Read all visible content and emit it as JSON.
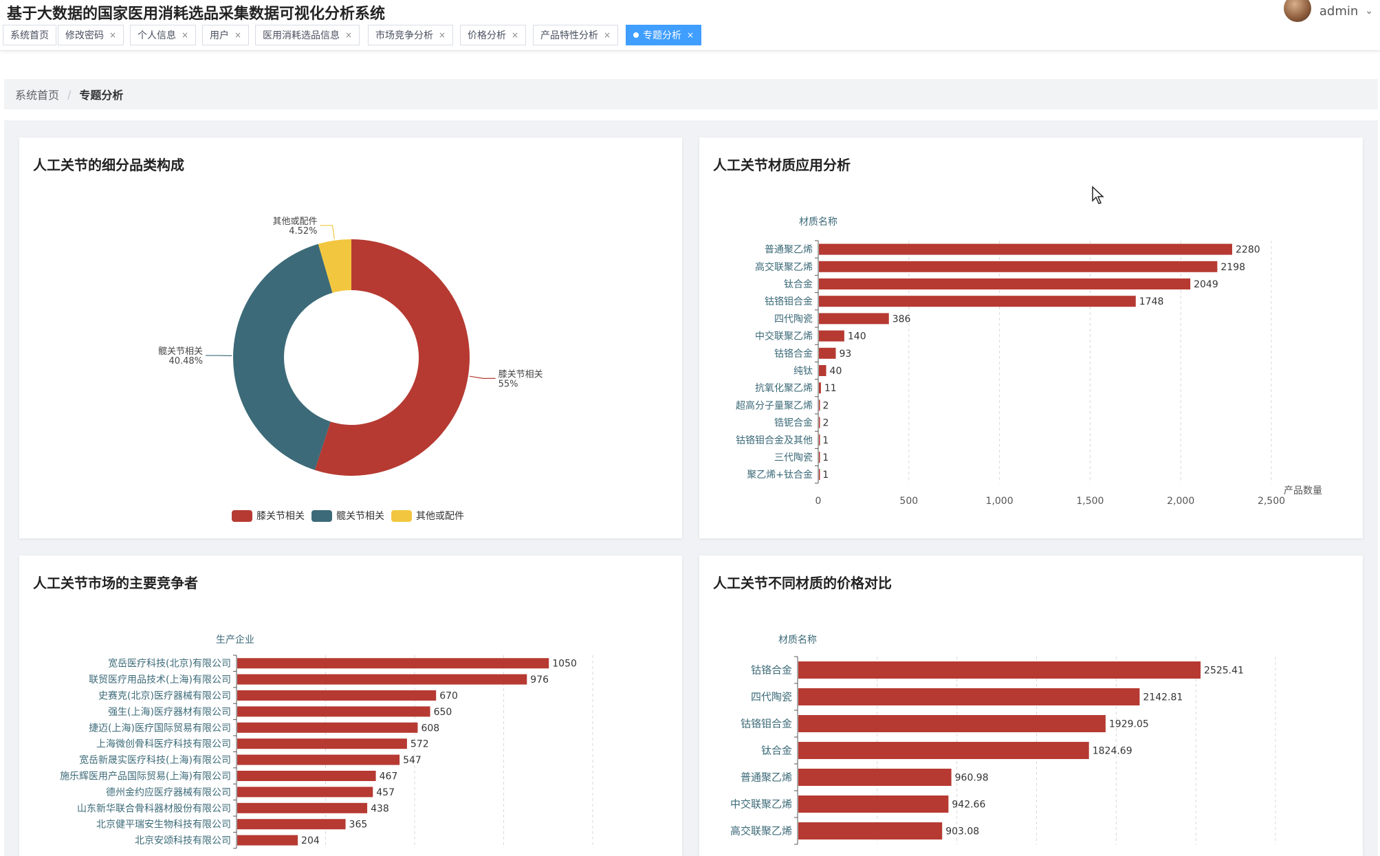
{
  "app": {
    "title": "基于大数据的国家医用消耗选品采集数据可视化分析系统",
    "user": "admin"
  },
  "tabs": [
    {
      "label": "系统首页",
      "closable": false
    },
    {
      "label": "修改密码",
      "closable": true
    },
    {
      "label": "个人信息",
      "closable": true
    },
    {
      "label": "用户",
      "closable": true
    },
    {
      "label": "医用消耗选品信息",
      "closable": true
    },
    {
      "label": "市场竞争分析",
      "closable": true
    },
    {
      "label": "价格分析",
      "closable": true
    },
    {
      "label": "产品特性分析",
      "closable": true
    },
    {
      "label": "专题分析",
      "closable": true,
      "active": true
    }
  ],
  "breadcrumb": {
    "home": "系统首页",
    "sep": "/",
    "current": "专题分析"
  },
  "panels": [
    {
      "title": "人工关节的细分品类构成"
    },
    {
      "title": "人工关节材质应用分析"
    },
    {
      "title": "人工关节市场的主要竞争者"
    },
    {
      "title": "人工关节不同材质的价格对比"
    }
  ],
  "colors": {
    "bar": "#b63a32",
    "pie": [
      "#b63a32",
      "#3c6a78",
      "#f3c63f"
    ],
    "active_tab": "#409eff",
    "axis_label": "#3c6a78"
  },
  "chart_data": [
    {
      "type": "pie",
      "variant": "donut",
      "title": "人工关节的细分品类构成",
      "slices": [
        {
          "name": "膝关节相关",
          "pct_label": "55%",
          "value": 55.0
        },
        {
          "name": "髋关节相关",
          "pct_label": "40.48%",
          "value": 40.48
        },
        {
          "name": "其他或配件",
          "pct_label": "4.52%",
          "value": 4.52
        }
      ],
      "legend": [
        "膝关节相关",
        "髋关节相关",
        "其他或配件"
      ],
      "legend_position": "bottom"
    },
    {
      "type": "bar",
      "orientation": "horizontal",
      "title": "人工关节材质应用分析",
      "ylabel": "材质名称",
      "xlabel": "产品数量",
      "categories": [
        "普通聚乙烯",
        "高交联聚乙烯",
        "钛合金",
        "钴铬钼合金",
        "四代陶瓷",
        "中交联聚乙烯",
        "钴铬合金",
        "纯钛",
        "抗氧化聚乙烯",
        "超高分子量聚乙烯",
        "锆铌合金",
        "钴铬钼合金及其他",
        "三代陶瓷",
        "聚乙烯+钛合金"
      ],
      "values": [
        2280,
        2198,
        2049,
        1748,
        386,
        140,
        93,
        40,
        11,
        2,
        2,
        1,
        1,
        1
      ],
      "xlim": [
        0,
        2500
      ],
      "xticks": [
        "0",
        "500",
        "1,000",
        "1,500",
        "2,000",
        "2,500"
      ],
      "grid": "vertical-dashed"
    },
    {
      "type": "bar",
      "orientation": "horizontal",
      "title": "人工关节市场的主要竞争者",
      "ylabel": "生产企业",
      "categories": [
        "宽岳医疗科技(北京)有限公司",
        "联贸医疗用品技术(上海)有限公司",
        "史赛克(北京)医疗器械有限公司",
        "强生(上海)医疗器材有限公司",
        "捷迈(上海)医疗国际贸易有限公司",
        "上海微创骨科医疗科技有限公司",
        "宽岳新晟实医疗科技(上海)有限公司",
        "施乐辉医用产品国际贸易(上海)有限公司",
        "德州金约应医疗器械有限公司",
        "山东新华联合骨科器材股份有限公司",
        "北京健平瑞安生物科技有限公司",
        "北京安颂科技有限公司"
      ],
      "values": [
        1050,
        976,
        670,
        650,
        608,
        572,
        547,
        467,
        457,
        438,
        365,
        204
      ],
      "xlim": [
        0,
        1200
      ],
      "grid": "vertical-dashed"
    },
    {
      "type": "bar",
      "orientation": "horizontal",
      "title": "人工关节不同材质的价格对比",
      "ylabel": "材质名称",
      "categories": [
        "钴铬合金",
        "四代陶瓷",
        "钴铬钼合金",
        "钛合金",
        "普通聚乙烯",
        "中交联聚乙烯",
        "高交联聚乙烯"
      ],
      "values": [
        2525.41,
        2142.81,
        1929.05,
        1824.69,
        960.98,
        942.66,
        903.08
      ],
      "value_labels": [
        "2525.41",
        "2142.81",
        "1929.05",
        "1824.69",
        "960.98",
        "942.66",
        "903.08"
      ],
      "xlim": [
        0,
        3000
      ],
      "grid": "vertical-dashed"
    }
  ]
}
